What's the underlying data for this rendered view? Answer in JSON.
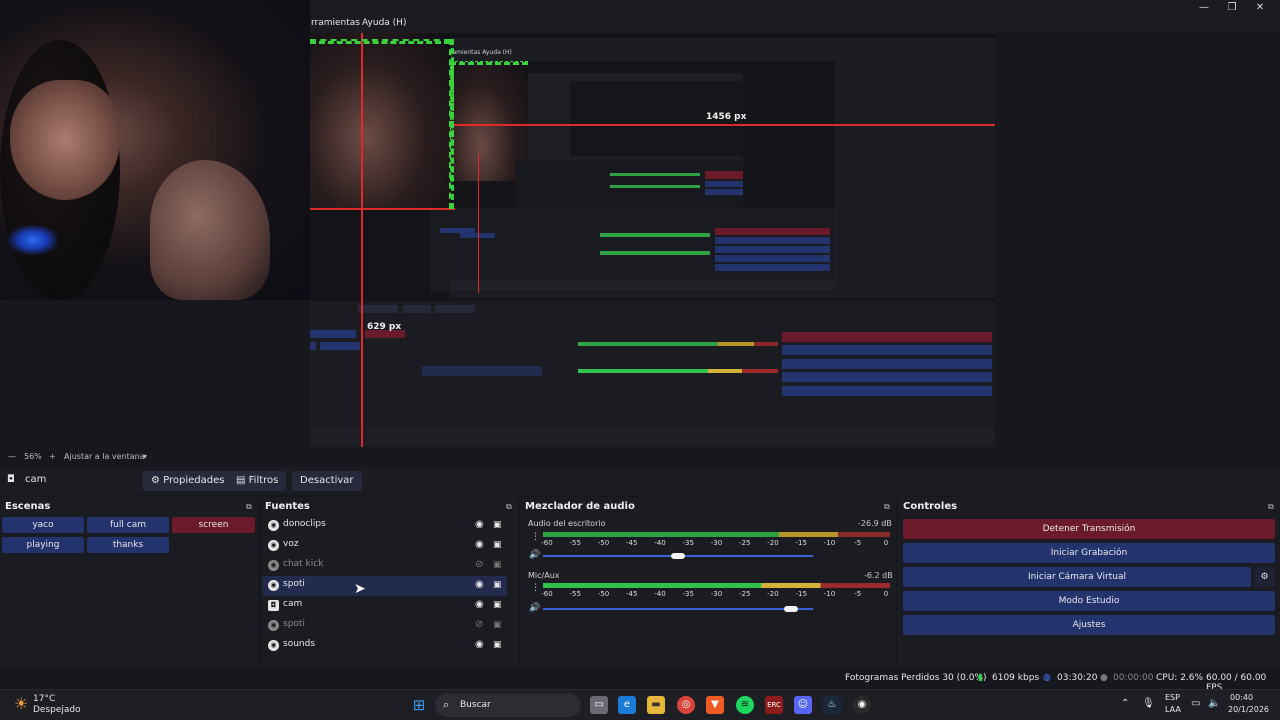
{
  "menu": {
    "items": [
      "rramientas",
      "Ayuda (H)"
    ]
  },
  "window_controls": {
    "minimize": "—",
    "restore": "❐",
    "close": "✕"
  },
  "preview": {
    "measure_labels": [
      "1456 px",
      "629 px"
    ],
    "nested_menu": "ramientas   Ayuda (H)"
  },
  "zoom": {
    "level": "56%",
    "fit_label": "Ajustar a la ventana"
  },
  "source_toolbar": {
    "selected_source": "cam",
    "properties_label": "Propiedades",
    "filters_label": "Filtros",
    "deactivate_label": "Desactivar"
  },
  "scenes": {
    "title": "Escenas",
    "items": [
      {
        "label": "yaco",
        "active": false
      },
      {
        "label": "full cam",
        "active": false
      },
      {
        "label": "screen",
        "active": true
      },
      {
        "label": "playing",
        "active": false
      },
      {
        "label": "thanks",
        "active": false
      }
    ]
  },
  "sources": {
    "title": "Fuentes",
    "items": [
      {
        "label": "donoclips",
        "visible": true
      },
      {
        "label": "voz",
        "visible": true
      },
      {
        "label": "chat kick",
        "visible": false
      },
      {
        "label": "spoti",
        "visible": true,
        "selected": true
      },
      {
        "label": "cam",
        "visible": true
      },
      {
        "label": "spoti",
        "visible": false
      },
      {
        "label": "sounds",
        "visible": true
      }
    ]
  },
  "mixer": {
    "title": "Mezclador de audio",
    "ticks": [
      "-60",
      "-55",
      "-50",
      "-45",
      "-40",
      "-35",
      "-30",
      "-25",
      "-20",
      "-15",
      "-10",
      "-5",
      "0"
    ],
    "channels": [
      {
        "name": "Audio del escritorio",
        "db": "-26.9 dB",
        "volume": 0.5
      },
      {
        "name": "Mic/Aux",
        "db": "-6.2 dB",
        "volume": 0.94
      }
    ]
  },
  "controls": {
    "title": "Controles",
    "stop_stream": "Detener Transmisión",
    "start_recording": "Iniciar Grabación",
    "start_virtual_cam": "Iniciar Cámara Virtual",
    "studio_mode": "Modo Estudio",
    "settings": "Ajustes"
  },
  "status": {
    "dropped_frames": "Fotogramas Perdidos 30 (0.0%)",
    "bitrate": "6109 kbps",
    "stream_time": "03:30:20",
    "rec_time": "00:00:00",
    "cpu": "CPU: 2.6%",
    "fps": "60.00 / 60.00 FPS"
  },
  "taskbar": {
    "weather_temp": "17°C",
    "weather_desc": "Despejado",
    "search_placeholder": "Buscar",
    "lang_top": "ESP",
    "lang_bottom": "LAA",
    "time": "00:40",
    "date": "20/1/2026"
  },
  "colors": {
    "accent_blue": "#23336e",
    "accent_red": "#6b1a2b",
    "meter_green": "#2fa243"
  }
}
